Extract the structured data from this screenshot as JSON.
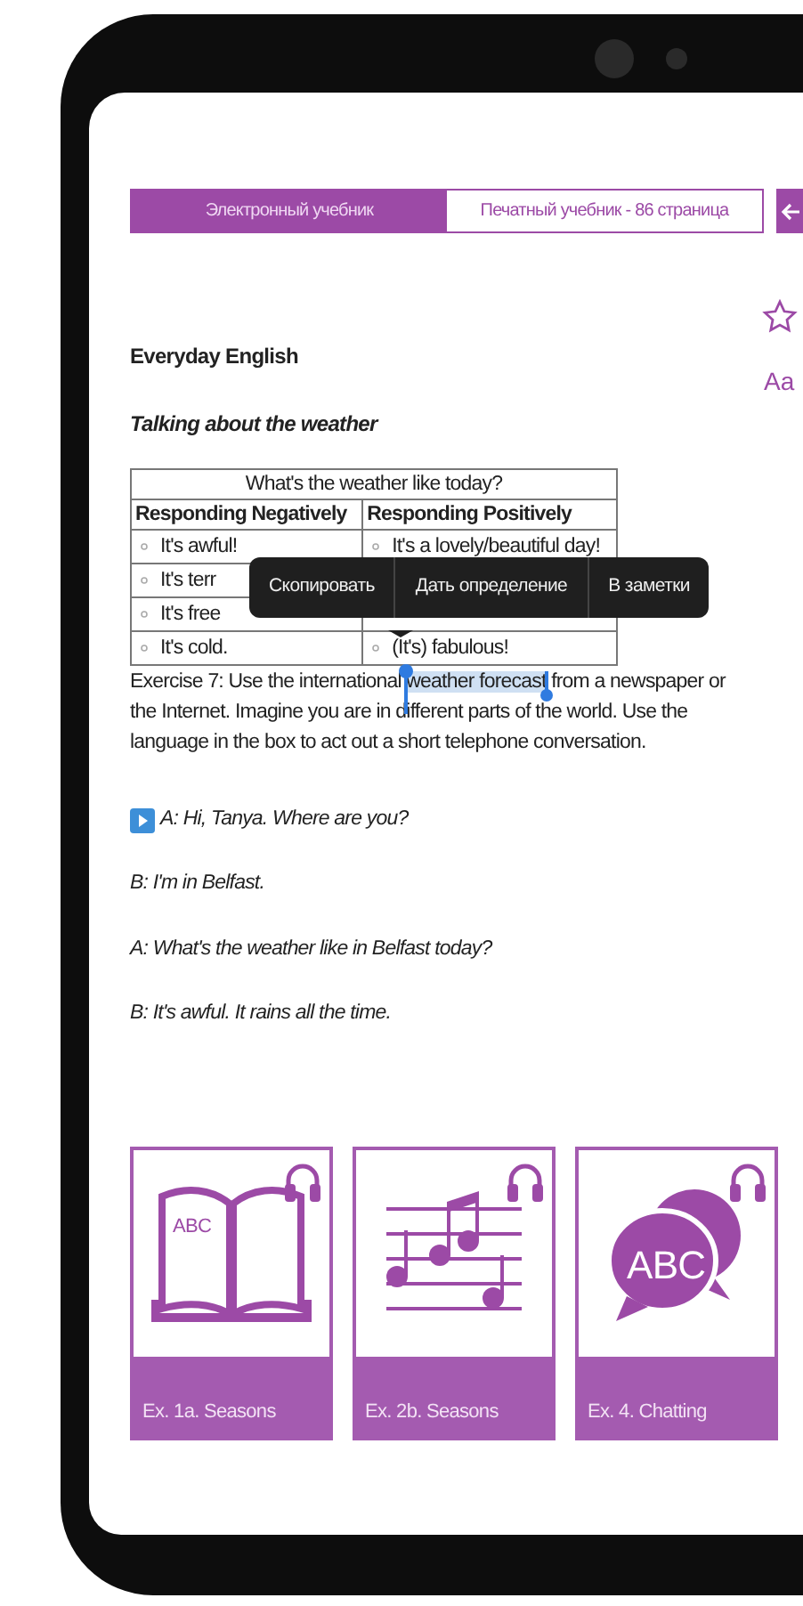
{
  "tabs": [
    {
      "label": "Электронный учебник",
      "selected": true
    },
    {
      "label": "Печатный учебник - 86 страница",
      "selected": false
    }
  ],
  "side_tools": {
    "font_button": "Aa"
  },
  "heading": "Everyday English",
  "subheading": "Talking about the weather",
  "table": {
    "title": "What's the weather like today?",
    "columns": [
      "Responding Negatively",
      "Responding Positively"
    ],
    "rows": [
      [
        "It's awful!",
        "It's a lovely/beautiful day!"
      ],
      [
        "It's terr",
        ""
      ],
      [
        "It's free",
        ""
      ],
      [
        "It's cold.",
        "(It's) fabulous!"
      ]
    ]
  },
  "context_menu": [
    "Скопировать",
    "Дать определение",
    "В заметки"
  ],
  "exercise": {
    "before": "Exercise 7: Use the international ",
    "selected": "weather forecast",
    "after": " from a newspaper or the Internet. Imagine you are in different parts of the world. Use the language in the box to act out a short telephone conversation."
  },
  "dialogue": [
    {
      "text": "A: Hi, Tanya. Where are you?",
      "audio": true
    },
    {
      "text": "B: I'm in Belfast.",
      "audio": false
    },
    {
      "text": "A: What's the weather like in Belfast today?",
      "audio": false
    },
    {
      "text": "B: It's awful. It rains all the time.",
      "audio": false
    }
  ],
  "cards": [
    {
      "kind": "book",
      "art_text": "ABC",
      "label": "Ex. 1a. Seasons"
    },
    {
      "kind": "music",
      "label": "Ex. 2b. Seasons"
    },
    {
      "kind": "chat",
      "art_text": "ABC",
      "label": "Ex. 4. Chatting"
    }
  ]
}
